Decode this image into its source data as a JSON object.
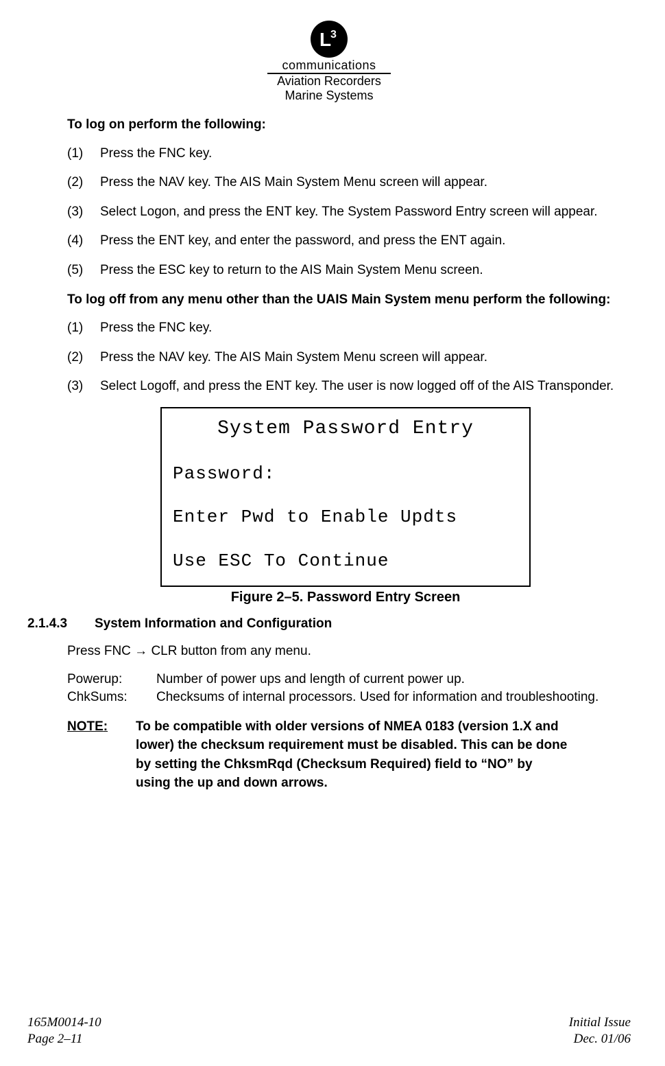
{
  "header": {
    "comm": "communications",
    "sub1": "Aviation Recorders",
    "sub2": "Marine Systems"
  },
  "logon_heading": "To log on perform the following:",
  "logon_steps": [
    "Press the FNC  key.",
    "Press the NAV key. The AIS Main System Menu screen will appear.",
    "Select Logon, and press the ENT key. The System Password Entry screen will appear.",
    "Press the ENT key, and enter the password, and press the ENT again.",
    "Press the ESC key to return to the AIS Main System Menu screen."
  ],
  "logoff_heading": "To log off from any menu other than the UAIS Main System menu perform the following:",
  "logoff_steps": [
    "Press the FNC  key.",
    "Press the NAV key. The AIS Main System Menu screen will appear.",
    "Select Logoff, and press the ENT key. The user is now logged off of the AIS Transponder."
  ],
  "figure": {
    "title": "System Password Entry",
    "line1": "Password:",
    "line2": "Enter Pwd to Enable Updts",
    "line3": "Use ESC To Continue",
    "caption": "Figure 2–5.  Password Entry Screen"
  },
  "section": {
    "num": "2.1.4.3",
    "title": "System Information and Configuration",
    "intro": "Press FNC → CLR button from any menu.",
    "defs": {
      "powerup_label": "Powerup:",
      "powerup_text": "Number of power ups and length of current power up.",
      "chksums_label": "ChkSums:",
      "chksums_text": "Checksums of internal processors.  Used for information and troubleshooting."
    },
    "note_label": "NOTE",
    "note_text": "To be compatible with older versions of NMEA 0183 (version 1.X and lower) the checksum requirement must be disabled.  This can be done by setting the ChksmRqd (Checksum Required) field to “NO” by using the up and down arrows."
  },
  "footer": {
    "left1": "165M0014-10",
    "left2": "Page 2–11",
    "right1": "Initial Issue",
    "right2": "Dec. 01/06"
  }
}
